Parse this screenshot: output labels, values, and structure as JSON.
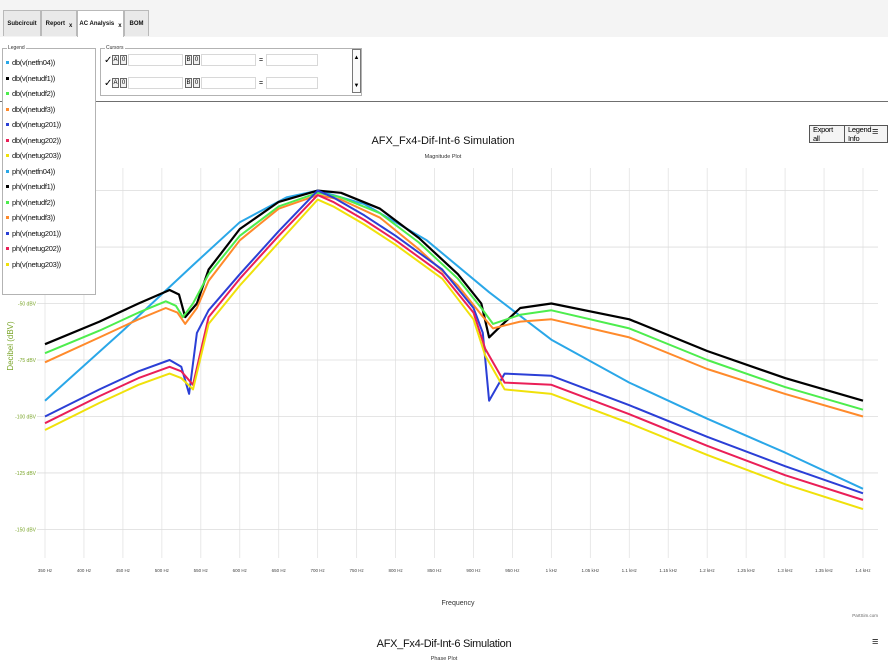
{
  "tabs": [
    {
      "label": "Subcircuit",
      "closable": false,
      "active": false
    },
    {
      "label": "Report",
      "closable": true,
      "active": false
    },
    {
      "label": "AC Analysis",
      "closable": true,
      "active": true
    },
    {
      "label": "BOM",
      "closable": false,
      "active": false
    }
  ],
  "close_glyph": "x",
  "legend_panel": {
    "title": "Legend",
    "items": [
      {
        "label": "db(v(netfn04))",
        "color": "#2aa7e8"
      },
      {
        "label": "db(v(netudf1))",
        "color": "#000000"
      },
      {
        "label": "db(v(netudf2))",
        "color": "#4ded4d"
      },
      {
        "label": "db(v(netudf3))",
        "color": "#ff8a2b"
      },
      {
        "label": "db(v(netug201))",
        "color": "#2b3fd6"
      },
      {
        "label": "db(v(netug202))",
        "color": "#ea1f57"
      },
      {
        "label": "db(v(netug203))",
        "color": "#f0e10a"
      },
      {
        "label": "ph(v(netfn04))",
        "color": "#2aa7e8"
      },
      {
        "label": "ph(v(netudf1))",
        "color": "#000000"
      },
      {
        "label": "ph(v(netudf2))",
        "color": "#4ded4d"
      },
      {
        "label": "ph(v(netudf3))",
        "color": "#ff8a2b"
      },
      {
        "label": "ph(v(netug201))",
        "color": "#2b3fd6"
      },
      {
        "label": "ph(v(netug202))",
        "color": "#ea1f57"
      },
      {
        "label": "ph(v(netug203))",
        "color": "#f0e10a"
      }
    ]
  },
  "cursors_panel": {
    "title": "Cursors",
    "rows": [
      {
        "check": "✓",
        "a_label": "A",
        "b_label": "B",
        "zero": "0",
        "eq": "="
      },
      {
        "check": "✓",
        "a_label": "A",
        "b_label": "B",
        "zero": "0",
        "eq": "="
      }
    ],
    "scroll_up": "▲",
    "scroll_down": "▼"
  },
  "export_button": {
    "label1": "Export all",
    "label2": "Legend Info"
  },
  "menu_glyph": "≡",
  "magnitude_chart": {
    "title": "AFX_Fx4-Dif-Int-6 Simulation",
    "subtitle": "Magnitude Plot",
    "xlabel": "Frequency",
    "ylabel": "Decibel (dBV)",
    "watermark": "PartSim.com"
  },
  "phase_chart": {
    "title": "AFX_Fx4-Dif-Int-6 Simulation",
    "subtitle": "Phase Plot"
  },
  "chart_data": {
    "type": "line",
    "title": "AFX_Fx4-Dif-Int-6 Simulation",
    "subtitle": "Magnitude Plot",
    "xlabel": "Frequency",
    "ylabel": "Decibel (dBV)",
    "x_unit": "Hz",
    "xlim": [
      350,
      1400
    ],
    "ylim": [
      -160,
      10
    ],
    "x_ticks": [
      350,
      400,
      450,
      500,
      550,
      600,
      650,
      700,
      750,
      800,
      850,
      900,
      950,
      1000,
      1050,
      1100,
      1150,
      1200,
      1250,
      1300,
      1350,
      1400
    ],
    "x_tick_labels": [
      "350 Hz",
      "400 Hz",
      "450 Hz",
      "500 Hz",
      "550 Hz",
      "600 Hz",
      "650 Hz",
      "700 Hz",
      "750 Hz",
      "800 Hz",
      "850 Hz",
      "900 Hz",
      "950 Hz",
      "1 kHz",
      "1.05 kHz",
      "1.1 kHz",
      "1.15 kHz",
      "1.2 kHz",
      "1.25 kHz",
      "1.3 kHz",
      "1.35 kHz",
      "1.4 kHz"
    ],
    "y_ticks": [
      -50,
      -75,
      -100,
      -125,
      -150
    ],
    "y_tick_labels": [
      "-50 dBV",
      "-75 dBV",
      "-100 dBV",
      "-125 dBV",
      "-150 dBV"
    ],
    "grid": true,
    "series": [
      {
        "name": "db(v(netfn04))",
        "color": "#2aa7e8",
        "x": [
          350,
          450,
          540,
          600,
          660,
          700,
          760,
          840,
          920,
          1000,
          1100,
          1200,
          1300,
          1400
        ],
        "y": [
          -93,
          -62,
          -33,
          -14,
          -3,
          0,
          -6,
          -22,
          -45,
          -66,
          -85,
          -101,
          -116,
          -132
        ]
      },
      {
        "name": "db(v(netudf1))",
        "color": "#000000",
        "x": [
          350,
          420,
          470,
          510,
          522,
          530,
          545,
          560,
          600,
          650,
          700,
          730,
          780,
          830,
          880,
          910,
          920,
          935,
          960,
          1000,
          1100,
          1200,
          1300,
          1400
        ],
        "y": [
          -68,
          -58,
          -50,
          -44,
          -46,
          -56,
          -50,
          -35,
          -17,
          -5,
          0,
          -1,
          -8,
          -21,
          -37,
          -50,
          -65,
          -60,
          -52,
          -50,
          -57,
          -71,
          -83,
          -93
        ]
      },
      {
        "name": "db(v(netudf2))",
        "color": "#4ded4d",
        "x": [
          350,
          420,
          470,
          505,
          518,
          527,
          540,
          560,
          600,
          650,
          700,
          730,
          780,
          830,
          880,
          910,
          925,
          960,
          1000,
          1100,
          1200,
          1300,
          1400
        ],
        "y": [
          -72,
          -62,
          -54,
          -49,
          -51,
          -56,
          -50,
          -37,
          -20,
          -7,
          -1,
          -3,
          -10,
          -23,
          -39,
          -52,
          -59,
          -55,
          -53,
          -61,
          -75,
          -87,
          -97
        ]
      },
      {
        "name": "db(v(netudf3))",
        "color": "#ff8a2b",
        "x": [
          350,
          420,
          470,
          505,
          520,
          530,
          545,
          560,
          600,
          650,
          700,
          730,
          780,
          830,
          880,
          910,
          925,
          960,
          1000,
          1100,
          1200,
          1300,
          1400
        ],
        "y": [
          -76,
          -65,
          -57,
          -52,
          -54,
          -59,
          -52,
          -40,
          -22,
          -8,
          -2,
          -4,
          -12,
          -26,
          -42,
          -55,
          -61,
          -58,
          -57,
          -65,
          -79,
          -90,
          -100
        ]
      },
      {
        "name": "db(v(netug201))",
        "color": "#2b3fd6",
        "x": [
          350,
          420,
          470,
          510,
          525,
          535,
          545,
          560,
          600,
          650,
          700,
          720,
          760,
          800,
          860,
          900,
          912,
          920,
          940,
          1000,
          1100,
          1200,
          1300,
          1400
        ],
        "y": [
          -100,
          -88,
          -80,
          -75,
          -78,
          -90,
          -63,
          -53,
          -37,
          -18,
          0,
          -3,
          -11,
          -20,
          -35,
          -52,
          -63,
          -93,
          -81,
          -82,
          -95,
          -109,
          -122,
          -134
        ]
      },
      {
        "name": "db(v(netug202))",
        "color": "#ea1f57",
        "x": [
          350,
          420,
          470,
          510,
          525,
          540,
          560,
          600,
          650,
          700,
          720,
          760,
          800,
          860,
          900,
          915,
          940,
          1000,
          1100,
          1200,
          1300,
          1400
        ],
        "y": [
          -103,
          -91,
          -83,
          -78,
          -80,
          -86,
          -56,
          -39,
          -20,
          -2,
          -5,
          -13,
          -22,
          -37,
          -54,
          -70,
          -85,
          -86,
          -99,
          -113,
          -126,
          -137
        ]
      },
      {
        "name": "db(v(netug203))",
        "color": "#f0e10a",
        "x": [
          350,
          420,
          470,
          510,
          525,
          540,
          560,
          600,
          650,
          700,
          720,
          760,
          800,
          860,
          900,
          915,
          940,
          1000,
          1100,
          1200,
          1300,
          1400
        ],
        "y": [
          -106,
          -94,
          -86,
          -81,
          -83,
          -88,
          -59,
          -42,
          -23,
          -4,
          -7,
          -15,
          -24,
          -39,
          -57,
          -73,
          -88,
          -90,
          -103,
          -117,
          -130,
          -141
        ]
      }
    ]
  }
}
